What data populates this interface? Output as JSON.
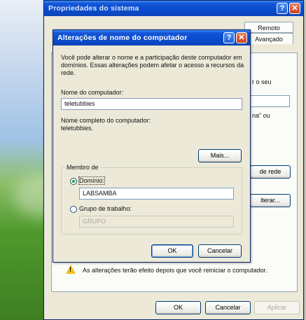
{
  "outer": {
    "title": "Propriedades do sistema",
    "help_icon": "help-icon",
    "close_icon": "close-icon",
    "tabs": [
      "Remoto",
      "Avançado"
    ],
    "partial_texts": [
      "r o seu",
      "na\" ou"
    ],
    "buttons": {
      "rede": "de rede",
      "alterar": "lterar...",
      "ok": "OK",
      "cancel": "Cancelar",
      "apply": "Aplicar"
    },
    "warning": "As alterações terão efeito depois que você reiniciar o computador."
  },
  "dialog": {
    "title": "Alterações de nome do computador",
    "description": "Você pode alterar o nome e a participação deste computador em domínios. Essas alterações podem afetar o acesso a recursos da rede.",
    "computer_name_label": "Nome do computador:",
    "computer_name_value": "teletubbies",
    "full_name_label": "Nome completo do computador:",
    "full_name_value": "teletubbies.",
    "more_button": "Mais...",
    "member_of_label": "Membro de",
    "domain_label": "Domínio:",
    "domain_value": "LABSAMBA",
    "workgroup_label": "Grupo de trabalho:",
    "workgroup_value": "GRUPO",
    "ok_button": "OK",
    "cancel_button": "Cancelar"
  },
  "colors": {
    "titlebar": "#0c45b8",
    "window": "#ece9d8",
    "close": "#c9401f"
  }
}
